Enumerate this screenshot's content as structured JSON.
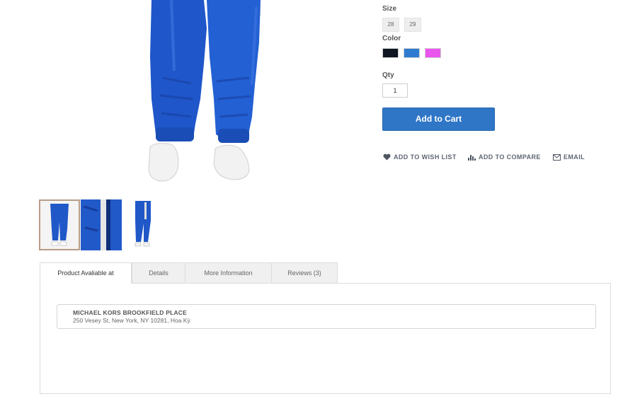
{
  "product_options": {
    "size_label": "Size",
    "sizes": [
      "28",
      "29"
    ],
    "color_label": "Color",
    "colors": [
      "#0f1621",
      "#2f7bd0",
      "#ea55ee"
    ],
    "qty_label": "Qty",
    "qty_value": "1",
    "add_to_cart": "Add to Cart"
  },
  "actions": {
    "wishlist": "ADD TO WISH LIST",
    "compare": "ADD TO COMPARE",
    "email": "EMAIL"
  },
  "tabs": [
    "Product Avaliable at",
    "Details",
    "More Information",
    "Reviews (3)"
  ],
  "store": {
    "name": "MICHAEL KORS BROOKFIELD PLACE",
    "address": "250 Vesey St, New York, NY 10281, Hoa Kỳ"
  },
  "icons": {
    "wishlist": "heart-icon",
    "compare": "bar-chart-icon",
    "email": "envelope-icon"
  }
}
